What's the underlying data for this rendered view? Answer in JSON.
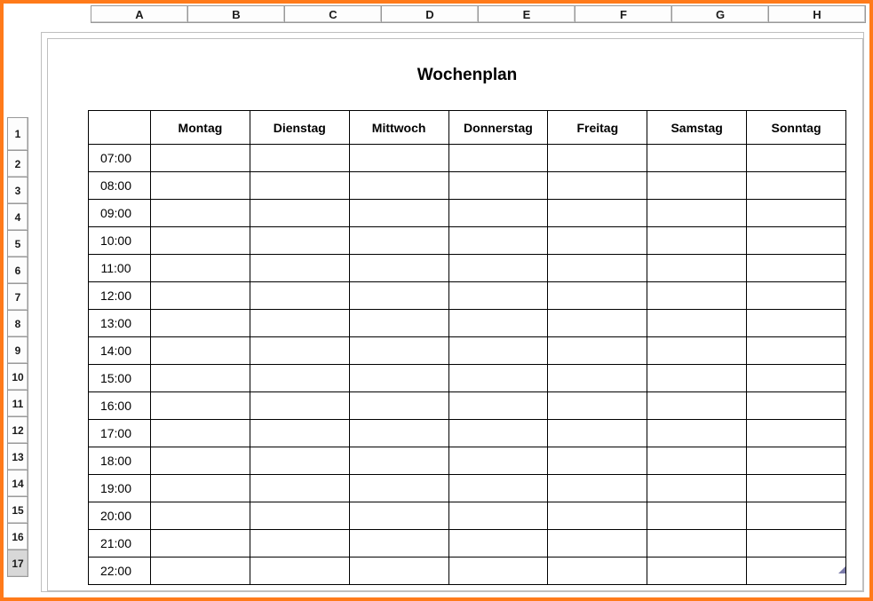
{
  "columns": [
    "A",
    "B",
    "C",
    "D",
    "E",
    "F",
    "G",
    "H"
  ],
  "rows": [
    "1",
    "2",
    "3",
    "4",
    "5",
    "6",
    "7",
    "8",
    "9",
    "10",
    "11",
    "12",
    "13",
    "14",
    "15",
    "16",
    "17"
  ],
  "selected_row": "17",
  "title": "Wochenplan",
  "days": [
    "Montag",
    "Dienstag",
    "Mittwoch",
    "Donnerstag",
    "Freitag",
    "Samstag",
    "Sonntag"
  ],
  "times": [
    "07:00",
    "08:00",
    "09:00",
    "10:00",
    "11:00",
    "12:00",
    "13:00",
    "14:00",
    "15:00",
    "16:00",
    "17:00",
    "18:00",
    "19:00",
    "20:00",
    "21:00",
    "22:00"
  ],
  "cells": [
    [
      "",
      "",
      "",
      "",
      "",
      "",
      ""
    ],
    [
      "",
      "",
      "",
      "",
      "",
      "",
      ""
    ],
    [
      "",
      "",
      "",
      "",
      "",
      "",
      ""
    ],
    [
      "",
      "",
      "",
      "",
      "",
      "",
      ""
    ],
    [
      "",
      "",
      "",
      "",
      "",
      "",
      ""
    ],
    [
      "",
      "",
      "",
      "",
      "",
      "",
      ""
    ],
    [
      "",
      "",
      "",
      "",
      "",
      "",
      ""
    ],
    [
      "",
      "",
      "",
      "",
      "",
      "",
      ""
    ],
    [
      "",
      "",
      "",
      "",
      "",
      "",
      ""
    ],
    [
      "",
      "",
      "",
      "",
      "",
      "",
      ""
    ],
    [
      "",
      "",
      "",
      "",
      "",
      "",
      ""
    ],
    [
      "",
      "",
      "",
      "",
      "",
      "",
      ""
    ],
    [
      "",
      "",
      "",
      "",
      "",
      "",
      ""
    ],
    [
      "",
      "",
      "",
      "",
      "",
      "",
      ""
    ],
    [
      "",
      "",
      "",
      "",
      "",
      "",
      ""
    ],
    [
      "",
      "",
      "",
      "",
      "",
      "",
      ""
    ]
  ]
}
